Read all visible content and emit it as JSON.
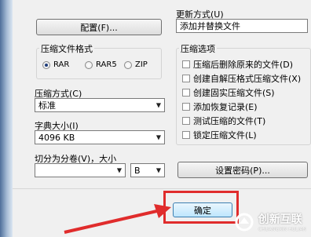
{
  "update_method": {
    "label": "更新方式(U)",
    "value": "添加并替换文件"
  },
  "config_button": "配置(F)...",
  "archive_format": {
    "title": "压缩文件格式",
    "options": [
      {
        "label": "RAR",
        "selected": true
      },
      {
        "label": "RAR5",
        "selected": false
      },
      {
        "label": "ZIP",
        "selected": false
      }
    ]
  },
  "compression_method": {
    "label": "压缩方式(C)",
    "value": "标准"
  },
  "dictionary_size": {
    "label": "字典大小(I)",
    "value": "4096 KB"
  },
  "split_volume": {
    "label": "切分为分卷(V)，大小",
    "size_value": "",
    "unit_value": "B"
  },
  "compression_options": {
    "title": "压缩选项",
    "items": [
      {
        "label": "压缩后删除原来的文件(D)",
        "checked": false
      },
      {
        "label": "创建自解压格式压缩文件(X)",
        "checked": false
      },
      {
        "label": "创建固实压缩文件(S)",
        "checked": false
      },
      {
        "label": "添加恢复记录(E)",
        "checked": false
      },
      {
        "label": "测试压缩的文件(T)",
        "checked": false
      },
      {
        "label": "锁定压缩文件(L)",
        "checked": false
      }
    ]
  },
  "set_password_button": "设置密码(P)...",
  "ok_button": "确定",
  "watermark": {
    "name": "创新互联",
    "sub": "CHUANGXIN HULIAN"
  },
  "colors": {
    "highlight": "#e02c2c",
    "dialog_bg": "#f0f0f0"
  }
}
